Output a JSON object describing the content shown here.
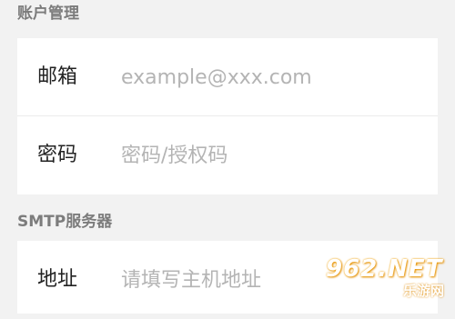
{
  "sections": {
    "account": {
      "title": "账户管理",
      "email": {
        "label": "邮箱",
        "placeholder": "example@xxx.com",
        "value": ""
      },
      "password": {
        "label": "密码",
        "placeholder": "密码/授权码",
        "value": ""
      }
    },
    "smtp": {
      "title": "SMTP服务器",
      "address": {
        "label": "地址",
        "placeholder": "请填写主机地址",
        "value": ""
      }
    }
  },
  "watermark": {
    "main": "962.NET",
    "sub": "乐游网"
  }
}
